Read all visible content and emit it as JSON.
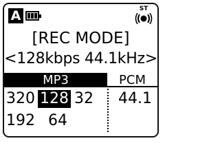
{
  "status_bar": {
    "mode": "A",
    "battery_icon": "battery-full-icon",
    "channel_label": "ST",
    "mic_icon": "stereo-mic-icon"
  },
  "title": "[REC MODE]",
  "current_value": "<128kbps 44.1kHz>",
  "tabs": {
    "mp3": "MP3",
    "pcm": "PCM"
  },
  "mp3_options": [
    "320",
    "128",
    "32",
    "192",
    "64"
  ],
  "selected_option": "128",
  "pcm_options": [
    "44.1"
  ]
}
